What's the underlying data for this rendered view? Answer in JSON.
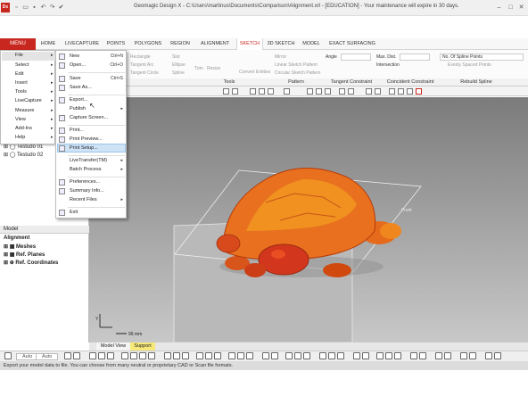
{
  "window": {
    "title": "Geomagic Design X - C:\\Users\\martinus\\Documents\\Comparison\\Alignment.xrl - [EDUCATION] - Your maintenance will expire in 30 days.",
    "app_icon": "Dx"
  },
  "ribbon_tabs": {
    "menu": "MENU",
    "items": [
      "HOME",
      "LIVECAPTURE",
      "POINTS",
      "POLYGONS",
      "REGION",
      "ALIGNMENT",
      "SKETCH",
      "3D SKETCH",
      "MODEL",
      "EXACT SURFACING"
    ],
    "active": "SKETCH"
  },
  "ribbon": {
    "rectangle": "Rectangle",
    "tangent_arc": "Tangent Arc",
    "tangent_circle": "Tangent Circle",
    "slot": "Slot",
    "ellipse": "Ellipse",
    "spline": "Spline",
    "trim": "Trim",
    "resize": "Resize",
    "convert_entities": "Convert Entities",
    "mirror": "Mirror",
    "linear_pattern": "Linear Sketch Pattern",
    "circular_pattern": "Circular Sketch Pattern",
    "angle": "Angle",
    "max_dist": "Max. Dist.",
    "intersection": "Intersection",
    "spline_points": "No. Of Spline Points",
    "evenly_spaced": "Evenly Spaced Points"
  },
  "ribbon_groups": [
    "Tools",
    "Pattern",
    "Tangent Constraint",
    "Coincident Constraint",
    "Rebuild Spline"
  ],
  "file_menu": {
    "items": [
      "File",
      "Select",
      "Edit",
      "Insert",
      "Tools",
      "LiveCapture",
      "Measure",
      "View",
      "Add-Ins",
      "Help"
    ]
  },
  "file_submenu": {
    "items": [
      {
        "label": "New",
        "shortcut": "Ctrl+N"
      },
      {
        "label": "Open...",
        "shortcut": "Ctrl+O"
      },
      {
        "label": "Save",
        "shortcut": "Ctrl+S"
      },
      {
        "label": "Save As...",
        "shortcut": ""
      },
      {
        "label": "Export...",
        "shortcut": ""
      },
      {
        "label": "Publish",
        "shortcut": ""
      },
      {
        "label": "Capture Screen...",
        "shortcut": ""
      },
      {
        "label": "Print...",
        "shortcut": ""
      },
      {
        "label": "Print Preview...",
        "shortcut": ""
      },
      {
        "label": "Print Setup...",
        "shortcut": ""
      },
      {
        "label": "LiveTransfer(TM)",
        "shortcut": ""
      },
      {
        "label": "Batch Process",
        "shortcut": ""
      },
      {
        "label": "Preferences...",
        "shortcut": ""
      },
      {
        "label": "Summary Info...",
        "shortcut": ""
      },
      {
        "label": "Recent Files",
        "shortcut": ""
      },
      {
        "label": "Exit",
        "shortcut": ""
      }
    ]
  },
  "left_panel": {
    "tree": [
      "Testudo 01",
      "Testudo 02"
    ],
    "model_header": "Model",
    "model_items": [
      "Alignment",
      "Meshes",
      "Ref. Planes",
      "Ref. Coordinates"
    ]
  },
  "viewport": {
    "front_label": "Front",
    "scale_label": "99 mm"
  },
  "bottom_tabs": {
    "tab1": "Model View",
    "tab2": "Support"
  },
  "bottom_toolbar": {
    "auto1": "Auto",
    "auto2": "Auto"
  },
  "status": "Export your model data to file. You can choose from many neutral or proprietary CAD or Scan file formats."
}
